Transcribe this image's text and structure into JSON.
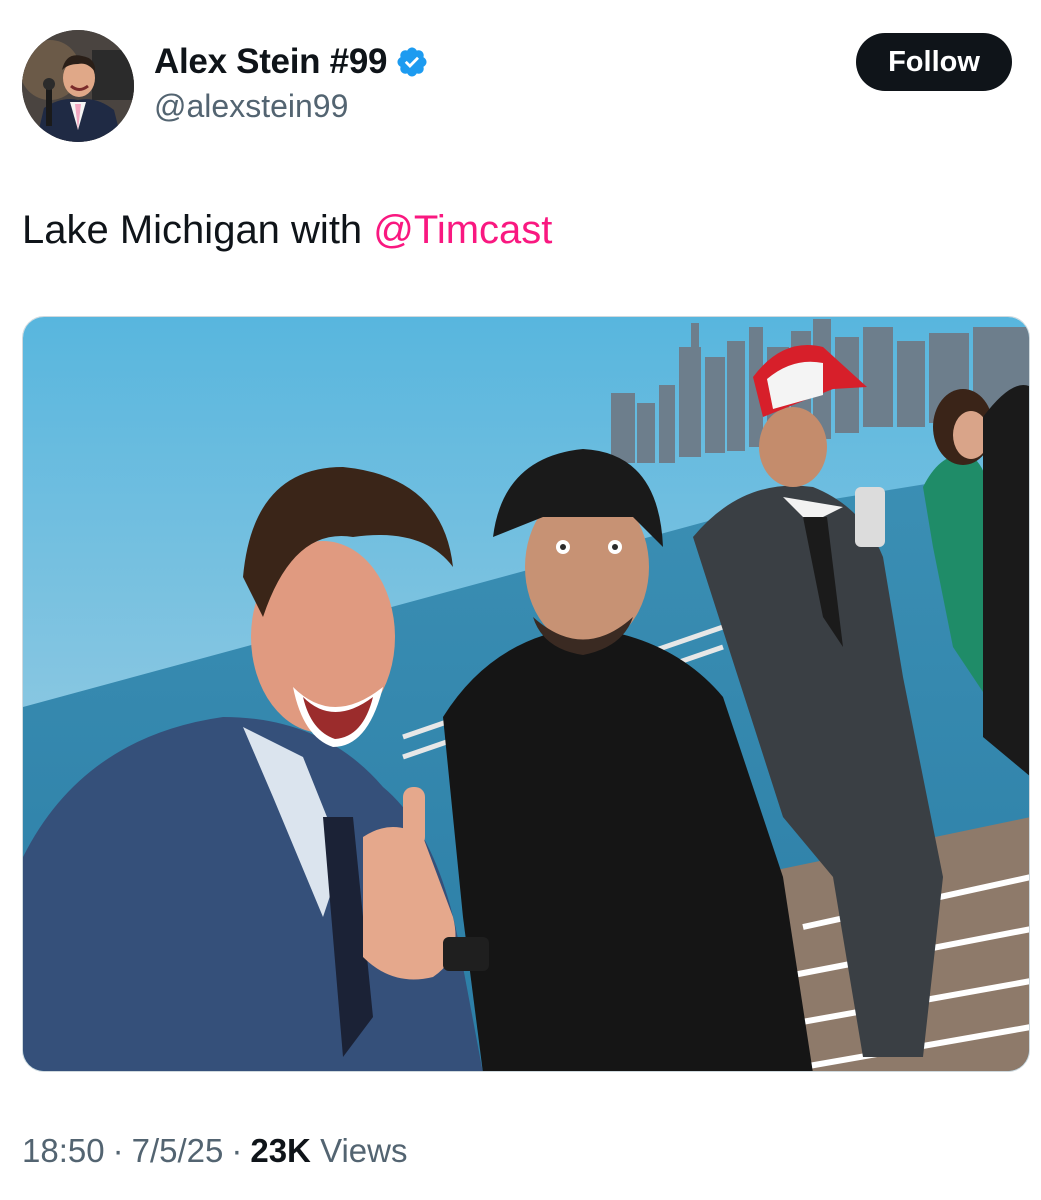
{
  "author": {
    "display_name": "Alex Stein #99",
    "handle": "@alexstein99",
    "verified": true,
    "avatar_icon": "profile-avatar"
  },
  "actions": {
    "follow_label": "Follow"
  },
  "tweet": {
    "text": "Lake Michigan with ",
    "mention": "@Timcast",
    "media": {
      "kind": "photo",
      "icon": "photo-image"
    }
  },
  "meta": {
    "time": "18:50",
    "date": "7/5/25",
    "views_count": "23K",
    "views_label": "Views",
    "separator": "·"
  },
  "colors": {
    "text": "#0f1419",
    "secondary": "#536471",
    "mention": "#f91880",
    "verified": "#1d9bf0",
    "follow_bg": "#0f1419"
  }
}
